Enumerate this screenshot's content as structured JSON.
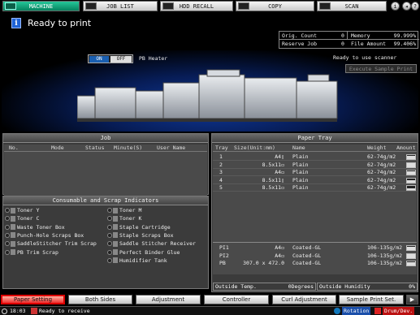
{
  "tabs": [
    {
      "label": "MACHINE",
      "active": true
    },
    {
      "label": "JOB LIST",
      "active": false
    },
    {
      "label": "HDD RECALL",
      "active": false
    },
    {
      "label": "COPY",
      "active": false
    },
    {
      "label": "SCAN",
      "active": false
    }
  ],
  "status": {
    "message": "Ready to print"
  },
  "counters": {
    "orig_count_label": "Orig. Count",
    "orig_count_value": "0",
    "reserve_job_label": "Reserve Job",
    "reserve_job_value": "0",
    "memory_label": "Memory",
    "memory_value": "99.999%",
    "file_amount_label": "File Amount",
    "file_amount_value": "99.406%"
  },
  "machine": {
    "pb_heater_label": "PB Heater",
    "on_label": "ON",
    "off_label": "OFF",
    "scanner_status": "Ready to use scanner",
    "execute_sample_label": "Execute Sample Print"
  },
  "job": {
    "title": "Job",
    "headers": [
      "No.",
      "Mode",
      "Status",
      "Minute(S)",
      "User Name"
    ]
  },
  "tray": {
    "title": "Paper Tray",
    "headers": [
      "Tray",
      "Size(Unit:mm)",
      "Name",
      "Weight",
      "Amount"
    ],
    "rows": [
      {
        "tray": "1",
        "size": "A4▯",
        "name": "Plain",
        "weight": "62-74g/m2",
        "amount": 0.9
      },
      {
        "tray": "2",
        "size": "8.5x11▭",
        "name": "Plain",
        "weight": "62-74g/m2",
        "amount": 0.9
      },
      {
        "tray": "3",
        "size": "A4▭",
        "name": "Plain",
        "weight": "62-74g/m2",
        "amount": 0.9
      },
      {
        "tray": "4",
        "size": "8.5x11▯",
        "name": "Plain",
        "weight": "62-74g/m2",
        "amount": 0.5
      },
      {
        "tray": "5",
        "size": "8.5x11▭",
        "name": "Plain",
        "weight": "62-74g/m2",
        "amount": 0.5
      }
    ],
    "special_rows": [
      {
        "tray": "PI1",
        "size": "A4▭",
        "name": "Coated-GL",
        "weight": "106-135g/m2",
        "amount": 0.9
      },
      {
        "tray": "PI2",
        "size": "A4▭",
        "name": "Coated-GL",
        "weight": "106-135g/m2",
        "amount": 0.9
      },
      {
        "tray": "PB",
        "size": "307.0 x 472.0",
        "name": "Coated-GL",
        "weight": "106-135g/m2",
        "amount": 0.9
      }
    ],
    "outside_temp_label": "Outside Temp.",
    "outside_temp_value": "0Degrees",
    "outside_humidity_label": "Outside Humidity",
    "outside_humidity_value": "0%"
  },
  "consumables": {
    "title": "Consumable and Scrap Indicators",
    "left": [
      "Toner Y",
      "Toner C",
      "Waste Toner Box",
      "Punch-Hole Scraps Box",
      "SaddleStitcher Trim Scrap",
      "PB Trim Scrap"
    ],
    "right": [
      "Toner M",
      "Toner K",
      "Staple Cartridge",
      "Staple Scraps Box",
      "Saddle Stitcher Receiver",
      "Perfect Binder Glue",
      "Humidifier Tank"
    ]
  },
  "bottom_buttons": [
    "Paper Setting",
    "Both Sides",
    "Adjustment",
    "Controller",
    "Curl Adjustment",
    "Sample Print Set."
  ],
  "footer": {
    "time": "18:03",
    "message": "Ready to receive",
    "rotation_label": "Rotation",
    "drum_label": "Drum/Dev."
  },
  "colors": {
    "accent": "#07a77a",
    "panel": "#3b3b3b",
    "status_red": "#e33333"
  }
}
